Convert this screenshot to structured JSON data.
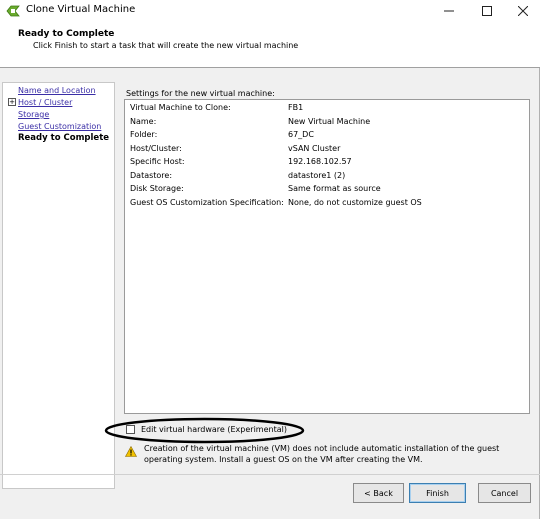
{
  "window": {
    "title": "Clone Virtual Machine",
    "minimize": "–",
    "maximize": "☐",
    "close": "✕",
    "icon": "vm-clone-icon"
  },
  "header": {
    "title": "Ready to Complete",
    "subtitle": "Click Finish to start a task that will create the new virtual machine"
  },
  "nav": {
    "items": [
      {
        "label": "Name and Location"
      },
      {
        "label": "Host / Cluster"
      },
      {
        "label": "Storage"
      },
      {
        "label": "Guest Customization"
      },
      {
        "label": "Ready to Complete"
      }
    ],
    "expand_glyph": "+"
  },
  "settings": {
    "label": "Settings for the new virtual machine:",
    "rows": [
      {
        "key": "Virtual Machine to Clone:",
        "value": "FB1"
      },
      {
        "key": "Name:",
        "value": "New Virtual Machine"
      },
      {
        "key": "Folder:",
        "value": "67_DC"
      },
      {
        "key": "Host/Cluster:",
        "value": "vSAN Cluster"
      },
      {
        "key": "Specific Host:",
        "value": "192.168.102.57"
      },
      {
        "key": "Datastore:",
        "value": "datastore1 (2)"
      },
      {
        "key": "Disk Storage:",
        "value": "Same format as source"
      },
      {
        "key": "Guest OS Customization Specification:",
        "value": "None, do not customize guest OS"
      }
    ]
  },
  "options": {
    "edit_hardware_label": "Edit virtual hardware (Experimental)",
    "edit_hardware_checked": false
  },
  "warning": {
    "text": "Creation of the virtual machine (VM) does not include automatic installation of the guest operating system. Install a guest OS on the VM after creating the VM."
  },
  "buttons": {
    "back": "< Back",
    "finish": "Finish",
    "cancel": "Cancel"
  },
  "colors": {
    "link": "#3a2ea6",
    "warning_yellow": "#f2c200",
    "annotation": "#000000"
  }
}
